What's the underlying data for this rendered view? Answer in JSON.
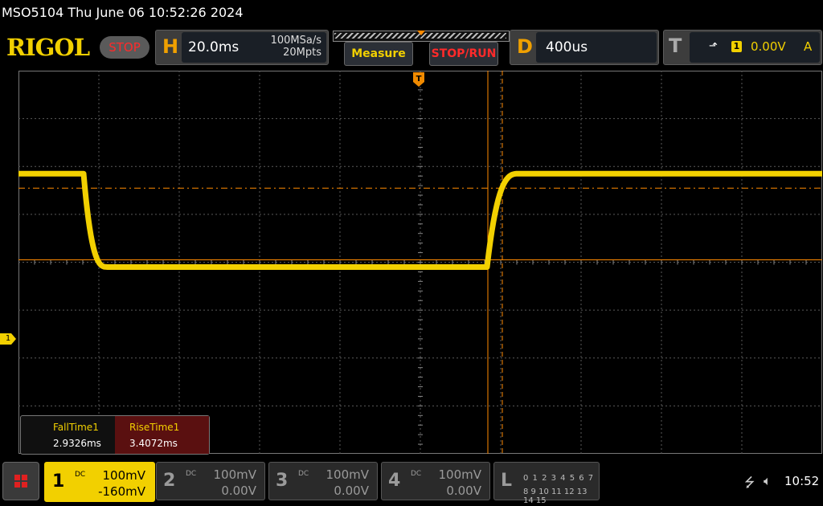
{
  "title_bar": {
    "text": "MSO5104  Thu June 06 10:52:26 2024"
  },
  "header": {
    "logo": "RIGOL",
    "run_state": "STOP",
    "horizontal": {
      "letter": "H",
      "timebase": "20.0ms",
      "sample_rate": "100MSa/s",
      "memory_depth": "20Mpts"
    },
    "measure_button": "Measure",
    "stop_run_button": "STOP/RUN",
    "delay": {
      "letter": "D",
      "value": "400us"
    },
    "trigger": {
      "letter": "T",
      "edge": "⬏",
      "source": "1",
      "level": "0.00V",
      "mode": "A"
    }
  },
  "colors": {
    "ch1": "#f2d000",
    "accent_orange": "#f0a000",
    "stop_red": "#ff2a2a",
    "grid": "#5a5a5a",
    "cursor_orange": "#ff8a00"
  },
  "waveform": {
    "channel": "CH1",
    "high_level_div": 5.85,
    "low_level_div": 3.9,
    "fall_edge_div": 0.85,
    "rise_edge_div": 5.85
  },
  "measurements": [
    {
      "label": "FallTime1",
      "value": "2.9326ms"
    },
    {
      "label": "RiseTime1",
      "value": "3.4072ms"
    }
  ],
  "ch1_marker": "1",
  "channels": [
    {
      "num": "1",
      "coupling": "DC",
      "scale": "100mV",
      "offset": "-160mV",
      "active": true
    },
    {
      "num": "2",
      "coupling": "DC",
      "scale": "100mV",
      "offset": "0.00V",
      "active": false
    },
    {
      "num": "3",
      "coupling": "DC",
      "scale": "100mV",
      "offset": "0.00V",
      "active": false
    },
    {
      "num": "4",
      "coupling": "DC",
      "scale": "100mV",
      "offset": "0.00V",
      "active": false
    }
  ],
  "logic": {
    "letter": "L",
    "row1": "0 1 2 3  4 5 6 7",
    "row2": "8 9 10 11 12 13 14 15"
  },
  "status": {
    "usb_icon": "usb-icon",
    "speaker_icon": "speaker-icon",
    "clock": "10:52"
  }
}
